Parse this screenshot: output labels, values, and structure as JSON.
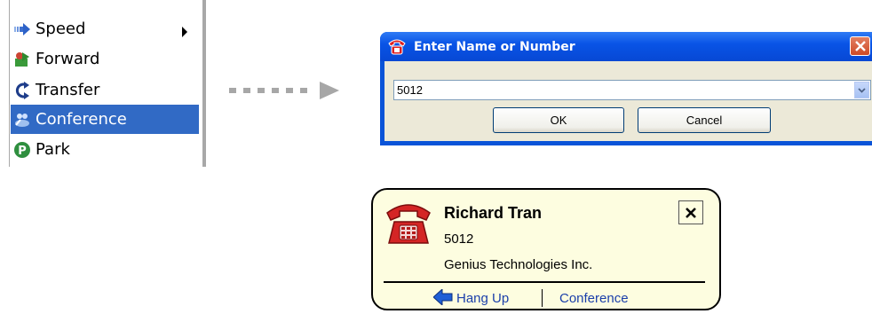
{
  "menu": {
    "items": [
      {
        "label": "Speed",
        "icon": "speed-arrow-icon",
        "has_submenu": true
      },
      {
        "label": "Forward",
        "icon": "forward-icon"
      },
      {
        "label": "Transfer",
        "icon": "transfer-icon"
      },
      {
        "label": "Conference",
        "icon": "conference-icon",
        "selected": true
      },
      {
        "label": "Park",
        "icon": "park-icon"
      }
    ]
  },
  "dialog": {
    "title": "Enter Name or Number",
    "input_value": "5012",
    "ok_label": "OK",
    "cancel_label": "Cancel"
  },
  "popup": {
    "name": "Richard Tran",
    "number": "5012",
    "company": "Genius Technologies Inc.",
    "hangup_label": "Hang Up",
    "conference_label": "Conference"
  },
  "colors": {
    "selection": "#316ac5",
    "title_bar": "#0954e6",
    "popup_bg": "#fdfde0",
    "link": "#1b3faa"
  }
}
